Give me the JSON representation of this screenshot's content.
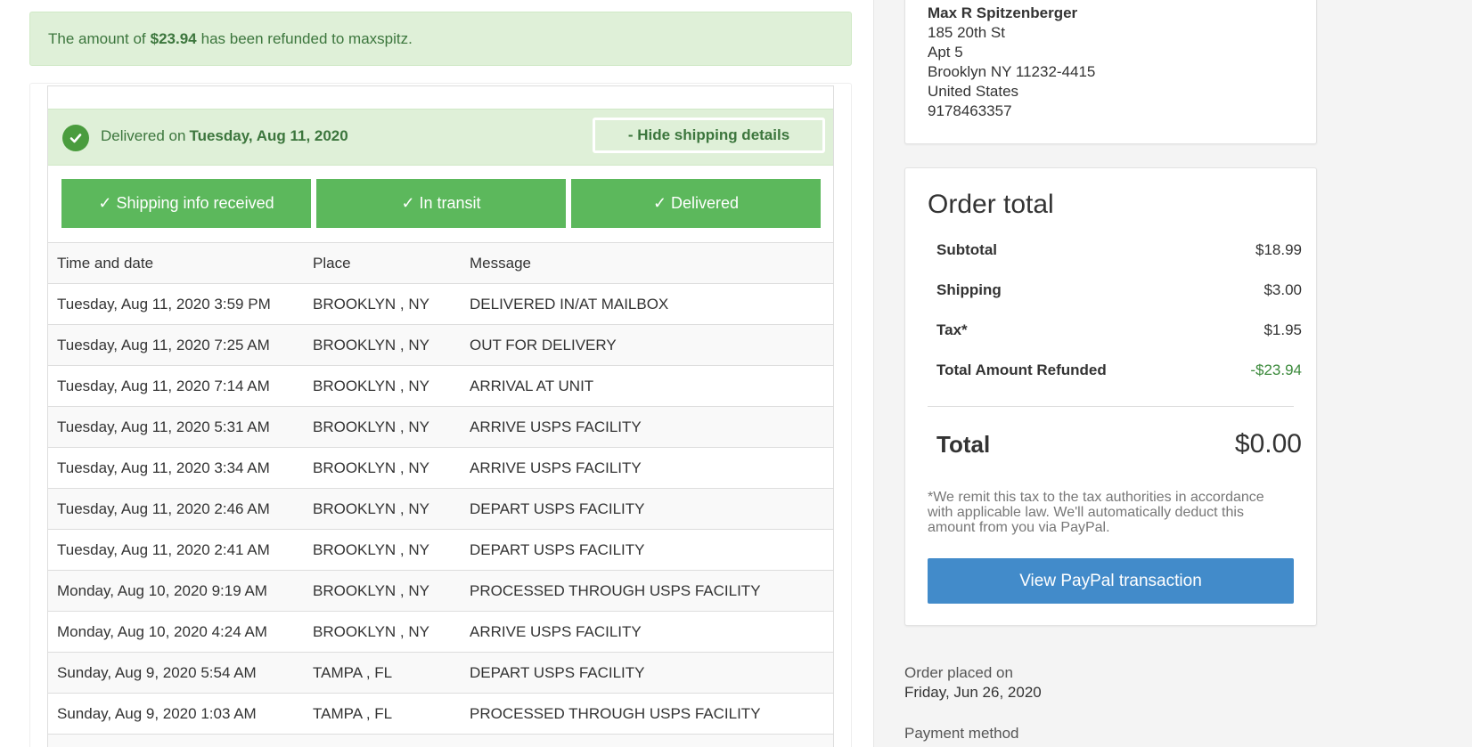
{
  "refund_alert": {
    "prefix": "The amount of",
    "amount": "$23.94",
    "suffix": "has been refunded to maxspitz."
  },
  "delivery_status": {
    "prefix": "Delivered on",
    "date": "Tuesday, Aug 11, 2020",
    "hide_button": "- Hide shipping details"
  },
  "steps": [
    {
      "label": "✓ Shipping info received"
    },
    {
      "label": "✓ In transit"
    },
    {
      "label": "✓ Delivered"
    }
  ],
  "tracking": {
    "headers": [
      "Time and date",
      "Place",
      "Message"
    ],
    "rows": [
      {
        "time": "Tuesday, Aug 11, 2020 3:59 PM",
        "place": "BROOKLYN , NY",
        "message": "DELIVERED IN/AT MAILBOX"
      },
      {
        "time": "Tuesday, Aug 11, 2020 7:25 AM",
        "place": "BROOKLYN , NY",
        "message": "OUT FOR DELIVERY"
      },
      {
        "time": "Tuesday, Aug 11, 2020 7:14 AM",
        "place": "BROOKLYN , NY",
        "message": "ARRIVAL AT UNIT"
      },
      {
        "time": "Tuesday, Aug 11, 2020 5:31 AM",
        "place": "BROOKLYN , NY",
        "message": "ARRIVE USPS FACILITY"
      },
      {
        "time": "Tuesday, Aug 11, 2020 3:34 AM",
        "place": "BROOKLYN , NY",
        "message": "ARRIVE USPS FACILITY"
      },
      {
        "time": "Tuesday, Aug 11, 2020 2:46 AM",
        "place": "BROOKLYN , NY",
        "message": "DEPART USPS FACILITY"
      },
      {
        "time": "Tuesday, Aug 11, 2020 2:41 AM",
        "place": "BROOKLYN , NY",
        "message": "DEPART USPS FACILITY"
      },
      {
        "time": "Monday, Aug 10, 2020 9:19 AM",
        "place": "BROOKLYN , NY",
        "message": "PROCESSED THROUGH USPS FACILITY"
      },
      {
        "time": "Monday, Aug 10, 2020 4:24 AM",
        "place": "BROOKLYN , NY",
        "message": "ARRIVE USPS FACILITY"
      },
      {
        "time": "Sunday, Aug 9, 2020 5:54 AM",
        "place": "TAMPA , FL",
        "message": "DEPART USPS FACILITY"
      },
      {
        "time": "Sunday, Aug 9, 2020 1:03 AM",
        "place": "TAMPA , FL",
        "message": "PROCESSED THROUGH USPS FACILITY"
      },
      {
        "time": "",
        "place": "",
        "message": ""
      }
    ]
  },
  "address": {
    "name": "Max R Spitzenberger",
    "line1": "185 20th St",
    "line2": "Apt 5",
    "line3": "Brooklyn NY 11232-4415",
    "country": "United States",
    "phone": "9178463357"
  },
  "order_total": {
    "title": "Order total",
    "rows": [
      {
        "label": "Subtotal",
        "value": "$18.99"
      },
      {
        "label": "Shipping",
        "value": "$3.00"
      },
      {
        "label": "Tax*",
        "value": "$1.95"
      },
      {
        "label": "Total Amount Refunded",
        "value": "-$23.94"
      }
    ],
    "total_label": "Total",
    "total_value": "$0.00",
    "tax_note": "*We remit this tax to the tax authorities in accordance with applicable law. We'll automatically deduct this amount from you via PayPal.",
    "paypal_button": "View PayPal transaction"
  },
  "order_meta": {
    "placed_label": "Order placed on",
    "placed_date": "Friday, Jun 26, 2020",
    "payment_label": "Payment method"
  },
  "colors": {
    "success_bg": "#dff0d8",
    "success_text": "#3c763d",
    "step_green": "#5cb85c",
    "paypal_blue": "#428bca",
    "refund_green": "#3c8a3c"
  }
}
